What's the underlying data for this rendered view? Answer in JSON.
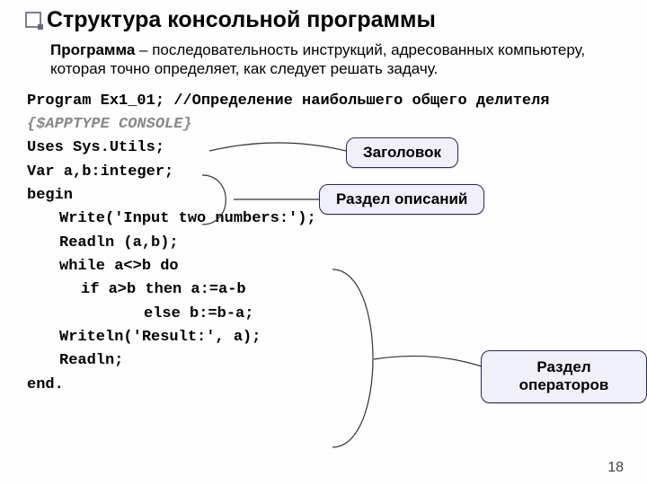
{
  "title": "Структура консольной программы",
  "description_term": "Программа",
  "description_rest": " – последовательность инструкций, адресованных компьютеру, которая точно определяет, как следует решать задачу.",
  "code": {
    "l1a": "Program Ex1_01; ",
    "l1b": "//Определение наибольшего общего делителя",
    "l2": "{$APPTYPE CONSOLE}",
    "l3": "Uses Sys.Utils;",
    "l4": "Var a,b:integer;",
    "l5": "begin",
    "l6": "Write('Input two numbers:');",
    "l7": "Readln (a,b);",
    "l8": "while a<>b do",
    "l9": "if a>b then a:=a-b",
    "l10": "else b:=b-a;",
    "l11": "Writeln('Result:', a);",
    "l12": "Readln;",
    "l13": "end."
  },
  "callouts": {
    "header": "Заголовок",
    "decl": "Раздел описаний",
    "ops": "Раздел операторов"
  },
  "page": "18"
}
